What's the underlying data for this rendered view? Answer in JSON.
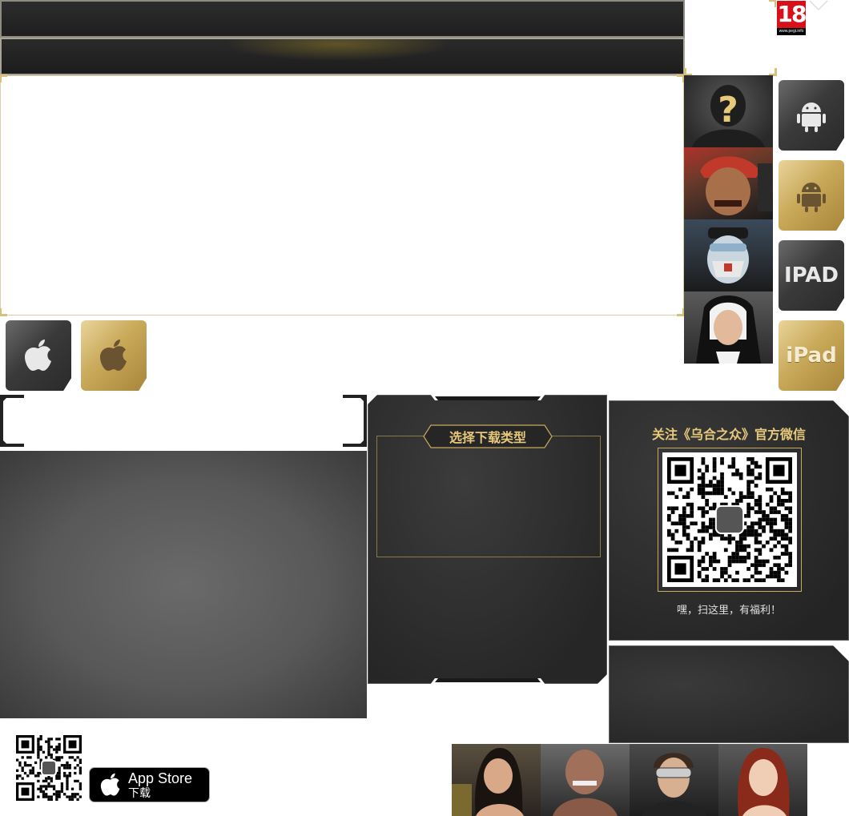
{
  "rating": {
    "age": "18",
    "url": "www.pegi.info"
  },
  "download": {
    "title": "选择下载类型"
  },
  "wechat": {
    "title": "关注《乌合之众》官方微信",
    "subtitle": "嘿，扫这里，有福利！"
  },
  "platforms": {
    "ipad_dark": "IPAD",
    "ipad_gold": "iPad"
  },
  "appstore": {
    "line1": "App Store",
    "line2": "下载"
  },
  "colors": {
    "gold": "#e7c97b",
    "pegi_red": "#d8101a",
    "panel_dark": "#2a2a2a"
  }
}
